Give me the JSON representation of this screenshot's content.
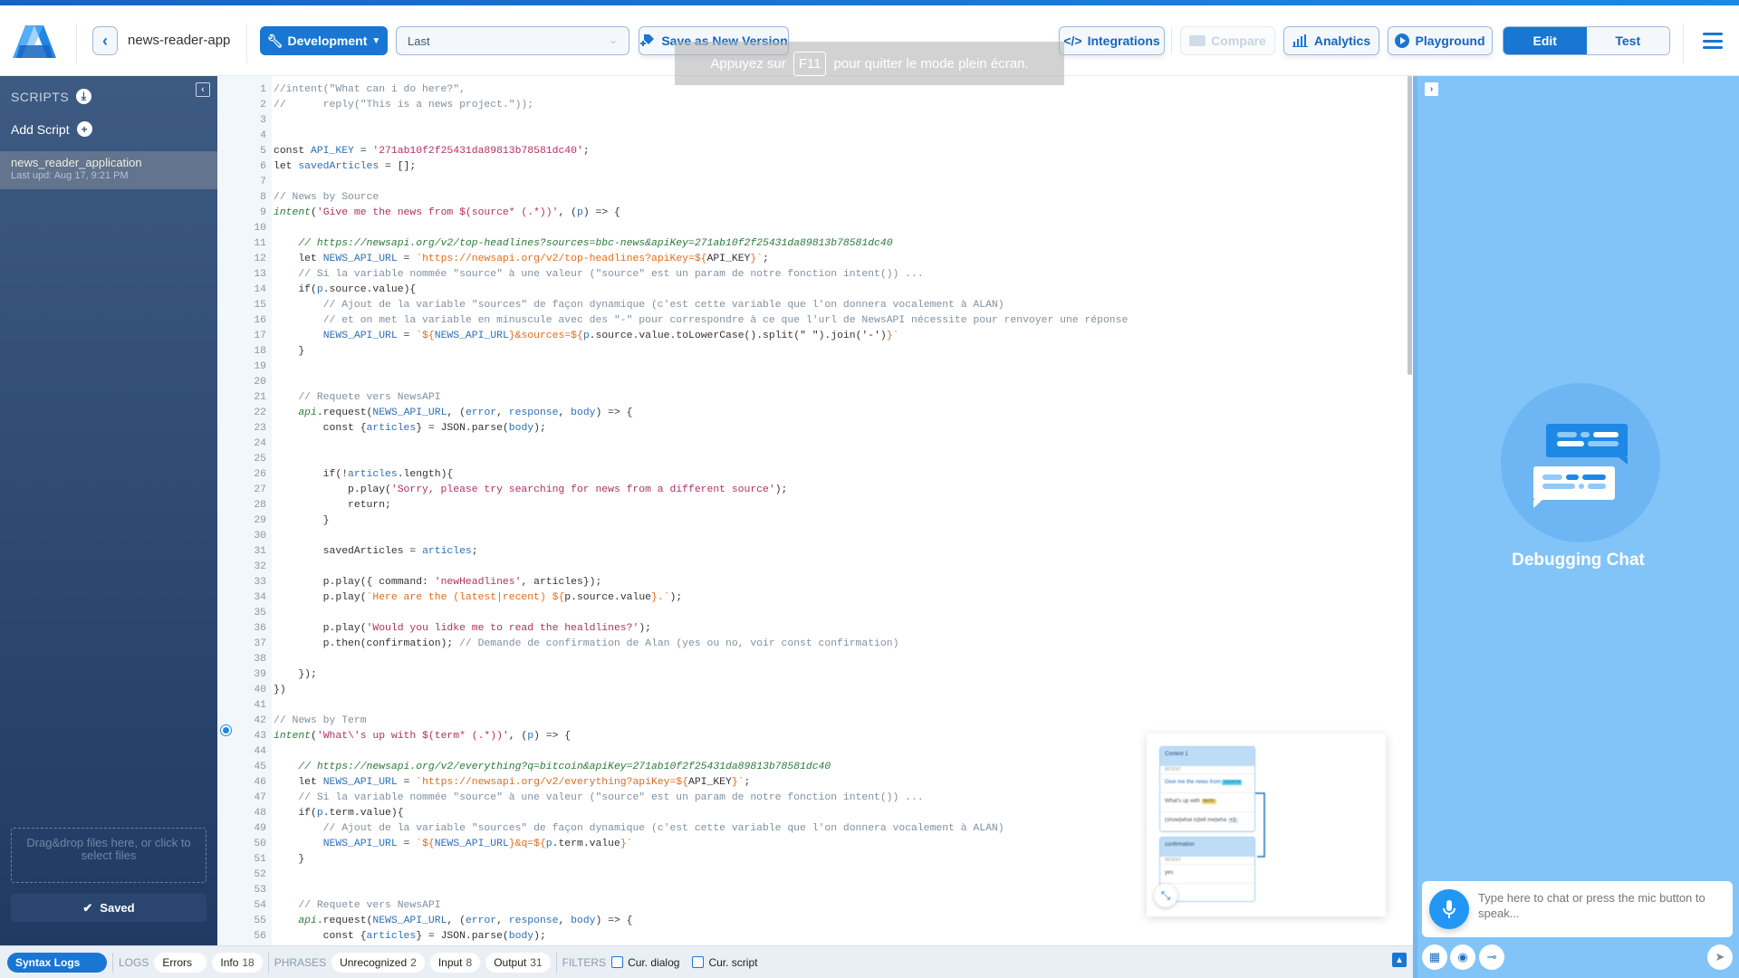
{
  "header": {
    "project_name": "news-reader-app",
    "environment_label": "Development",
    "version_selected": "Last",
    "save_version_label": "Save as New Version",
    "integrations_label": "Integrations",
    "compare_label": "Compare",
    "analytics_label": "Analytics",
    "playground_label": "Playground",
    "mode_tabs": [
      {
        "label": "Edit",
        "active": true
      },
      {
        "label": "Test",
        "active": false
      }
    ]
  },
  "fullscreen_notice": {
    "prefix": "Appuyez sur",
    "key": "F11",
    "suffix": "pour quitter le mode plein écran."
  },
  "sidebar": {
    "title": "SCRIPTS",
    "add_script_label": "Add Script",
    "scripts": [
      {
        "name": "news_reader_application",
        "updated": "Last upd: Aug 17, 9:21 PM",
        "active": true
      }
    ],
    "dropzone_text": "Drag&drop files here, or click to select files",
    "saved_label": "Saved"
  },
  "editor": {
    "lines": [
      [
        [
          "cm",
          "//intent(\"What can i do here?\",",
          ""
        ]
      ],
      [
        [
          "cm",
          "//      reply(\"This is a news project.\"));"
        ]
      ],
      [],
      [],
      [
        [
          "kw",
          "const "
        ],
        [
          "id",
          "API_KEY"
        ],
        [
          "kw",
          " = "
        ],
        [
          "st",
          "'271ab10f2f25431da89813b78581dc40'"
        ],
        [
          "kw",
          ";"
        ]
      ],
      [
        [
          "kw",
          "let "
        ],
        [
          "id",
          "savedArticles"
        ],
        [
          "kw",
          " = [];"
        ]
      ],
      [],
      [
        [
          "cm",
          "// News by Source"
        ]
      ],
      [
        [
          "fn",
          "intent"
        ],
        [
          "kw",
          "("
        ],
        [
          "st",
          "'Give me the news from $(source* (.*))'"
        ],
        [
          "kw",
          ", ("
        ],
        [
          "id",
          "p"
        ],
        [
          "kw",
          ") => {"
        ]
      ],
      [],
      [
        [
          "kw",
          "    "
        ],
        [
          "cmi",
          "// https://newsapi.org/v2/top-headlines?sources=bbc-news&apiKey=271ab10f2f25431da89813b78581dc40"
        ]
      ],
      [
        [
          "kw",
          "    let "
        ],
        [
          "id",
          "NEWS_API_URL"
        ],
        [
          "kw",
          " = "
        ],
        [
          "tp",
          "`https://newsapi.org/v2/top-headlines?apiKey=${"
        ],
        [
          "kw",
          "API_KEY"
        ],
        [
          "tp",
          "}`"
        ],
        [
          "kw",
          ";"
        ]
      ],
      [
        [
          "kw",
          "    "
        ],
        [
          "cm",
          "// Si la variable nommée \"source\" à une valeur (\"source\" est un param de notre fonction intent()) ..."
        ]
      ],
      [
        [
          "kw",
          "    if("
        ],
        [
          "id",
          "p"
        ],
        [
          "kw",
          ".source.value){"
        ]
      ],
      [
        [
          "kw",
          "        "
        ],
        [
          "cm",
          "// Ajout de la variable \"sources\" de façon dynamique (c'est cette variable que l'on donnera vocalement à ALAN)"
        ]
      ],
      [
        [
          "kw",
          "        "
        ],
        [
          "cm",
          "// et on met la variable en minuscule avec des \"-\" pour correspondre à ce que l'url de NewsAPI nécessite pour renvoyer une réponse"
        ]
      ],
      [
        [
          "kw",
          "        "
        ],
        [
          "id",
          "NEWS_API_URL"
        ],
        [
          "kw",
          " = "
        ],
        [
          "tp",
          "`${"
        ],
        [
          "id",
          "NEWS_API_URL"
        ],
        [
          "tp",
          "}&sources=${"
        ],
        [
          "id",
          "p"
        ],
        [
          "kw",
          ".source.value.toLowerCase().split(\" \").join('-')"
        ],
        [
          "tp",
          "}`"
        ]
      ],
      [
        [
          "kw",
          "    }"
        ]
      ],
      [],
      [],
      [
        [
          "kw",
          "    "
        ],
        [
          "cm",
          "// Requete vers NewsAPI"
        ]
      ],
      [
        [
          "kw",
          "    "
        ],
        [
          "fn",
          "api"
        ],
        [
          "kw",
          ".request("
        ],
        [
          "id",
          "NEWS_API_URL"
        ],
        [
          "kw",
          ", ("
        ],
        [
          "id",
          "error"
        ],
        [
          "kw",
          ", "
        ],
        [
          "id",
          "response"
        ],
        [
          "kw",
          ", "
        ],
        [
          "id",
          "body"
        ],
        [
          "kw",
          ") => {"
        ]
      ],
      [
        [
          "kw",
          "        const {"
        ],
        [
          "id",
          "articles"
        ],
        [
          "kw",
          "} = JSON.parse("
        ],
        [
          "id",
          "body"
        ],
        [
          "kw",
          ");"
        ]
      ],
      [],
      [],
      [
        [
          "kw",
          "        if(!"
        ],
        [
          "id",
          "articles"
        ],
        [
          "kw",
          ".length){"
        ]
      ],
      [
        [
          "kw",
          "            p.play("
        ],
        [
          "st",
          "'Sorry, please try searching for news from a different source'"
        ],
        [
          "kw",
          ");"
        ]
      ],
      [
        [
          "kw",
          "            return;"
        ]
      ],
      [
        [
          "kw",
          "        }"
        ]
      ],
      [],
      [
        [
          "kw",
          "        savedArticles = "
        ],
        [
          "id",
          "articles"
        ],
        [
          "kw",
          ";"
        ]
      ],
      [],
      [
        [
          "kw",
          "        p.play({ command: "
        ],
        [
          "st",
          "'newHeadlines'"
        ],
        [
          "kw",
          ", articles});"
        ]
      ],
      [
        [
          "kw",
          "        p.play("
        ],
        [
          "tp",
          "`Here are the (latest|recent) ${"
        ],
        [
          "kw",
          "p.source.value"
        ],
        [
          "tp",
          "}.`"
        ],
        [
          "kw",
          ");"
        ]
      ],
      [],
      [
        [
          "kw",
          "        p.play("
        ],
        [
          "st",
          "'Would you lidke me to read the healdlines?'"
        ],
        [
          "kw",
          ");"
        ]
      ],
      [
        [
          "kw",
          "        p.then(confirmation); "
        ],
        [
          "cm",
          "// Demande de confirmation de Alan (yes ou no, voir const confirmation)"
        ]
      ],
      [],
      [
        [
          "kw",
          "    });"
        ]
      ],
      [
        [
          "kw",
          "})"
        ]
      ],
      [],
      [
        [
          "cm",
          "// News by Term"
        ]
      ],
      [
        [
          "fn",
          "intent"
        ],
        [
          "kw",
          "("
        ],
        [
          "st",
          "'What\\'s up with $(term* (.*))'"
        ],
        [
          "kw",
          ", ("
        ],
        [
          "id",
          "p"
        ],
        [
          "kw",
          ") => {"
        ]
      ],
      [],
      [
        [
          "kw",
          "    "
        ],
        [
          "cmi",
          "// https://newsapi.org/v2/everything?q=bitcoin&apiKey=271ab10f2f25431da89813b78581dc40"
        ]
      ],
      [
        [
          "kw",
          "    let "
        ],
        [
          "id",
          "NEWS_API_URL"
        ],
        [
          "kw",
          " = "
        ],
        [
          "tp",
          "`https://newsapi.org/v2/everything?apiKey=${"
        ],
        [
          "kw",
          "API_KEY"
        ],
        [
          "tp",
          "}`"
        ],
        [
          "kw",
          ";"
        ]
      ],
      [
        [
          "kw",
          "    "
        ],
        [
          "cm",
          "// Si la variable nommée \"source\" à une valeur (\"source\" est un param de notre fonction intent()) ..."
        ]
      ],
      [
        [
          "kw",
          "    if("
        ],
        [
          "id",
          "p"
        ],
        [
          "kw",
          ".term.value){"
        ]
      ],
      [
        [
          "kw",
          "        "
        ],
        [
          "cm",
          "// Ajout de la variable \"sources\" de façon dynamique (c'est cette variable que l'on donnera vocalement à ALAN)"
        ]
      ],
      [
        [
          "kw",
          "        "
        ],
        [
          "id",
          "NEWS_API_URL"
        ],
        [
          "kw",
          " = "
        ],
        [
          "tp",
          "`${"
        ],
        [
          "id",
          "NEWS_API_URL"
        ],
        [
          "tp",
          "}&q=${"
        ],
        [
          "id",
          "p"
        ],
        [
          "kw",
          ".term.value"
        ],
        [
          "tp",
          "}`"
        ]
      ],
      [
        [
          "kw",
          "    }"
        ]
      ],
      [],
      [],
      [
        [
          "kw",
          "    "
        ],
        [
          "cm",
          "// Requete vers NewsAPI"
        ]
      ],
      [
        [
          "kw",
          "    "
        ],
        [
          "fn",
          "api"
        ],
        [
          "kw",
          ".request("
        ],
        [
          "id",
          "NEWS_API_URL"
        ],
        [
          "kw",
          ", ("
        ],
        [
          "id",
          "error"
        ],
        [
          "kw",
          ", "
        ],
        [
          "id",
          "response"
        ],
        [
          "kw",
          ", "
        ],
        [
          "id",
          "body"
        ],
        [
          "kw",
          ") => {"
        ]
      ],
      [
        [
          "kw",
          "        const {"
        ],
        [
          "id",
          "articles"
        ],
        [
          "kw",
          "} = JSON.parse("
        ],
        [
          "id",
          "body"
        ],
        [
          "kw",
          ");"
        ]
      ],
      []
    ]
  },
  "flow_preview": {
    "contexts": [
      {
        "title": "Context 1",
        "label": "INTENT",
        "rows": [
          {
            "text": "Give me the news from",
            "slot": "source",
            "slot_color": "#5fd3e8"
          },
          {
            "text": "What's up with",
            "slot": "term",
            "slot_color": "#f6d76b"
          },
          {
            "text": "(show|what is|tell me|wha",
            "slot": "+1",
            "slot_color": "#dde3ea"
          }
        ]
      },
      {
        "title": "confirmation",
        "label": "INTENT",
        "rows": [
          {
            "text": "yes",
            "slot": "",
            "slot_color": ""
          }
        ]
      }
    ]
  },
  "logbar": {
    "syntax_logs_label": "Syntax Logs",
    "logs_group": "LOGS",
    "errors_label": "Errors",
    "info_label": "Info",
    "info_count": "18",
    "phrases_group": "PHRASES",
    "unrecognized_label": "Unrecognized",
    "unrecognized_count": "2",
    "input_label": "Input",
    "input_count": "8",
    "output_label": "Output",
    "output_count": "31",
    "filters_group": "FILTERS",
    "cur_dialog_label": "Cur. dialog",
    "cur_script_label": "Cur. script"
  },
  "debug_panel": {
    "title": "Debugging Chat",
    "chat_placeholder": "Type here to chat or press the mic button to speak..."
  }
}
